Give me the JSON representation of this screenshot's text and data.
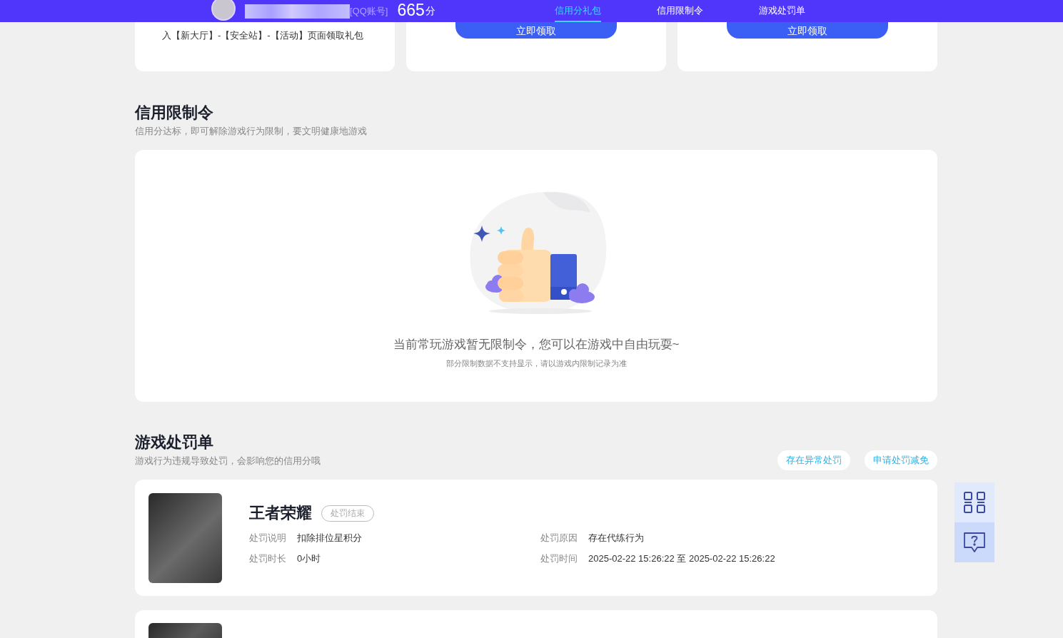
{
  "header": {
    "account_suffix": "[QQ账号]",
    "score": "665",
    "score_unit": "分",
    "tabs": [
      {
        "label": "信用分礼包",
        "selected": true
      },
      {
        "label": "信用限制令",
        "selected": false
      },
      {
        "label": "游戏处罚单",
        "selected": false
      }
    ]
  },
  "gift_cards": [
    {
      "kind": "text",
      "text": "入【新大厅】-【安全站】-【活动】页面领取礼包"
    },
    {
      "kind": "button",
      "button": "立即领取"
    },
    {
      "kind": "button",
      "button": "立即领取"
    }
  ],
  "restriction": {
    "title": "信用限制令",
    "subtitle": "信用分达标，即可解除游戏行为限制，要文明健康地游戏",
    "empty_message": "当前常玩游戏暂无限制令，您可以在游戏中自由玩耍~",
    "empty_note": "部分限制数据不支持显示，请以游戏内限制记录为准"
  },
  "penalties": {
    "title": "游戏处罚单",
    "subtitle": "游戏行为违规导致处罚，会影响您的信用分哦",
    "actions": [
      "存在异常处罚",
      "申请处罚减免"
    ],
    "records": [
      {
        "kind": "full",
        "game": "王者荣耀",
        "status": "处罚结束",
        "fields": [
          {
            "label": "处罚说明",
            "value": "扣除排位星积分"
          },
          {
            "label": "处罚原因",
            "value": "存在代练行为"
          },
          {
            "label": "处罚时长",
            "value": "0小时"
          },
          {
            "label": "处罚时间",
            "value": "2025-02-22 15:26:22 至 2025-02-22 15:26:22"
          }
        ]
      },
      {
        "kind": "cut_off"
      }
    ]
  }
}
